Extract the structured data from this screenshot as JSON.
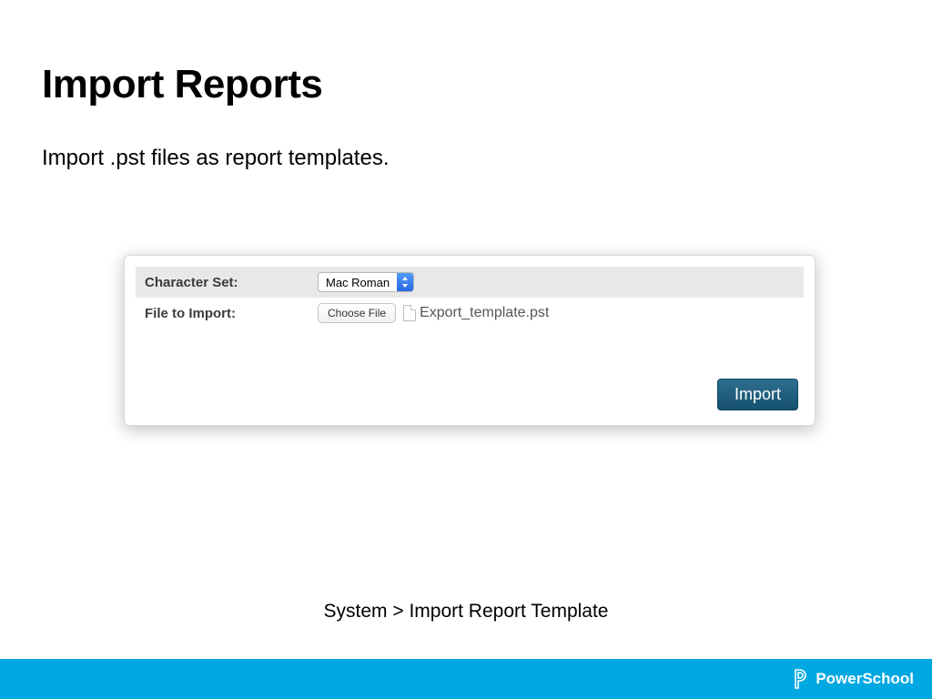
{
  "title": "Import Reports",
  "subtitle": "Import .pst files as report templates.",
  "form": {
    "charset_label": "Character Set:",
    "charset_value": "Mac Roman",
    "file_label": "File to Import:",
    "choose_file_label": "Choose File",
    "selected_file": "Export_template.pst",
    "import_button": "Import"
  },
  "breadcrumb": "System > Import Report Template",
  "footer_brand": "PowerSchool"
}
